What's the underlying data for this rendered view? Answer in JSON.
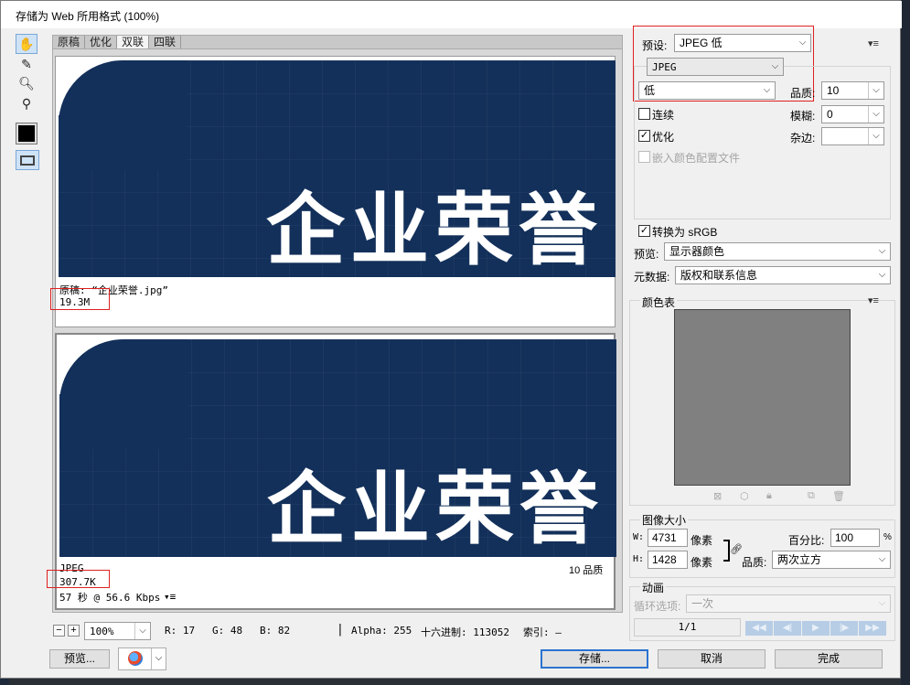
{
  "window": {
    "title": "存储为 Web 所用格式 (100%)"
  },
  "tabs": [
    "原稿",
    "优化",
    "双联",
    "四联"
  ],
  "selected_tab": "双联",
  "preview": {
    "image_text": "企业荣誉",
    "original": {
      "label": "原稿: “企业荣誉.jpg”",
      "size": "19.3M"
    },
    "optimized": {
      "format": "JPEG",
      "size": "307.7K",
      "time": "57 秒 @ 56.6 Kbps",
      "quality": "10 品质"
    }
  },
  "status": {
    "zoom": "100%",
    "r": "R: 17",
    "g": "G: 48",
    "b": "B: 82",
    "alpha": "Alpha: 255",
    "hex": "十六进制: 113052",
    "index": "索引: —"
  },
  "buttons": {
    "preview": "预览...",
    "save": "存储...",
    "cancel": "取消",
    "done": "完成"
  },
  "settings": {
    "preset_label": "预设:",
    "preset_value": "JPEG 低",
    "format_value": "JPEG",
    "quality_preset": "低",
    "quality_label": "品质:",
    "quality_value": "10",
    "progressive_label": "连续",
    "blur_label": "模糊:",
    "blur_value": "0",
    "optimized_label": "优化",
    "matte_label": "杂边:",
    "matte_value": "",
    "embed_profile_label": "嵌入颜色配置文件",
    "convert_srgb_label": "转换为 sRGB",
    "preview_label": "预览:",
    "preview_value": "显示器颜色",
    "metadata_label": "元数据:",
    "metadata_value": "版权和联系信息",
    "color_table_label": "颜色表"
  },
  "image_size": {
    "title": "图像大小",
    "w_label": "W:",
    "w_value": "4731",
    "w_unit": "像素",
    "h_label": "H:",
    "h_value": "1428",
    "h_unit": "像素",
    "percent_label": "百分比:",
    "percent_value": "100",
    "percent_unit": "%",
    "quality_label": "品质:",
    "quality_value": "两次立方"
  },
  "animation": {
    "title": "动画",
    "loop_label": "循环选项:",
    "loop_value": "一次",
    "frame": "1/1"
  },
  "colors": {
    "accent": "#2a73d0",
    "image_bg": "#13305a",
    "highlight": "#e02020"
  }
}
